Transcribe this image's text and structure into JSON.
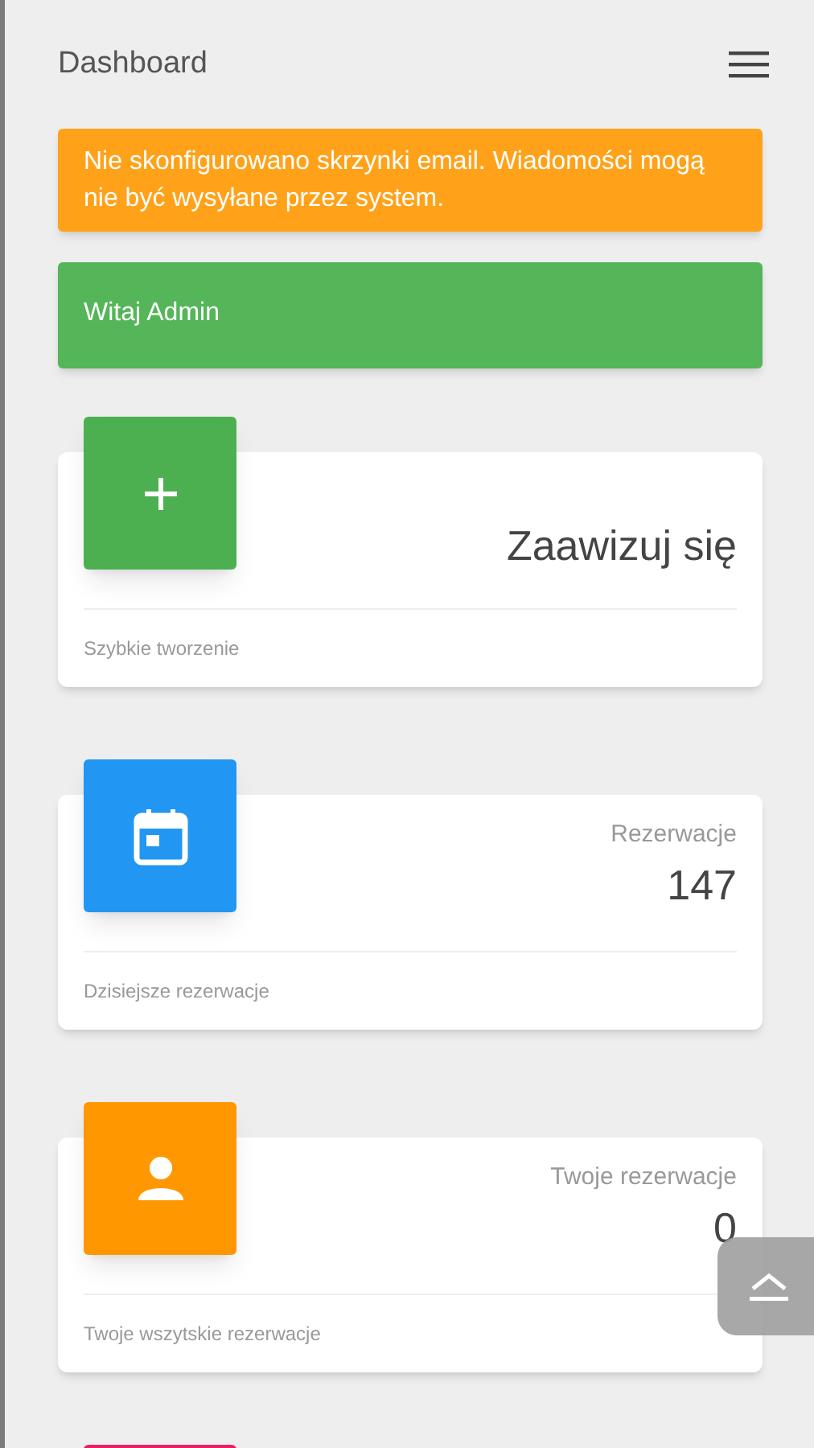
{
  "header": {
    "title": "Dashboard"
  },
  "alerts": [
    {
      "kind": "warning",
      "text": "Nie skonfigurowano skrzynki email. Wiadomości mogą nie być wysyłane przez system."
    },
    {
      "kind": "success",
      "text": "Witaj Admin"
    }
  ],
  "cards": [
    {
      "kind": "plus",
      "color": "#4caf50",
      "value": "Zaawizuj się",
      "footer": "Szybkie tworzenie"
    },
    {
      "kind": "calendar",
      "color": "#2196f3",
      "label": "Rezerwacje",
      "value": "147",
      "footer": "Dzisiejsze rezerwacje"
    },
    {
      "kind": "person",
      "color": "#ff9800",
      "label": "Twoje rezerwacje",
      "value": "0",
      "footer": "Twoje wszytskie rezerwacje"
    },
    {
      "kind": "unknown",
      "color": "#e91e63"
    }
  ]
}
